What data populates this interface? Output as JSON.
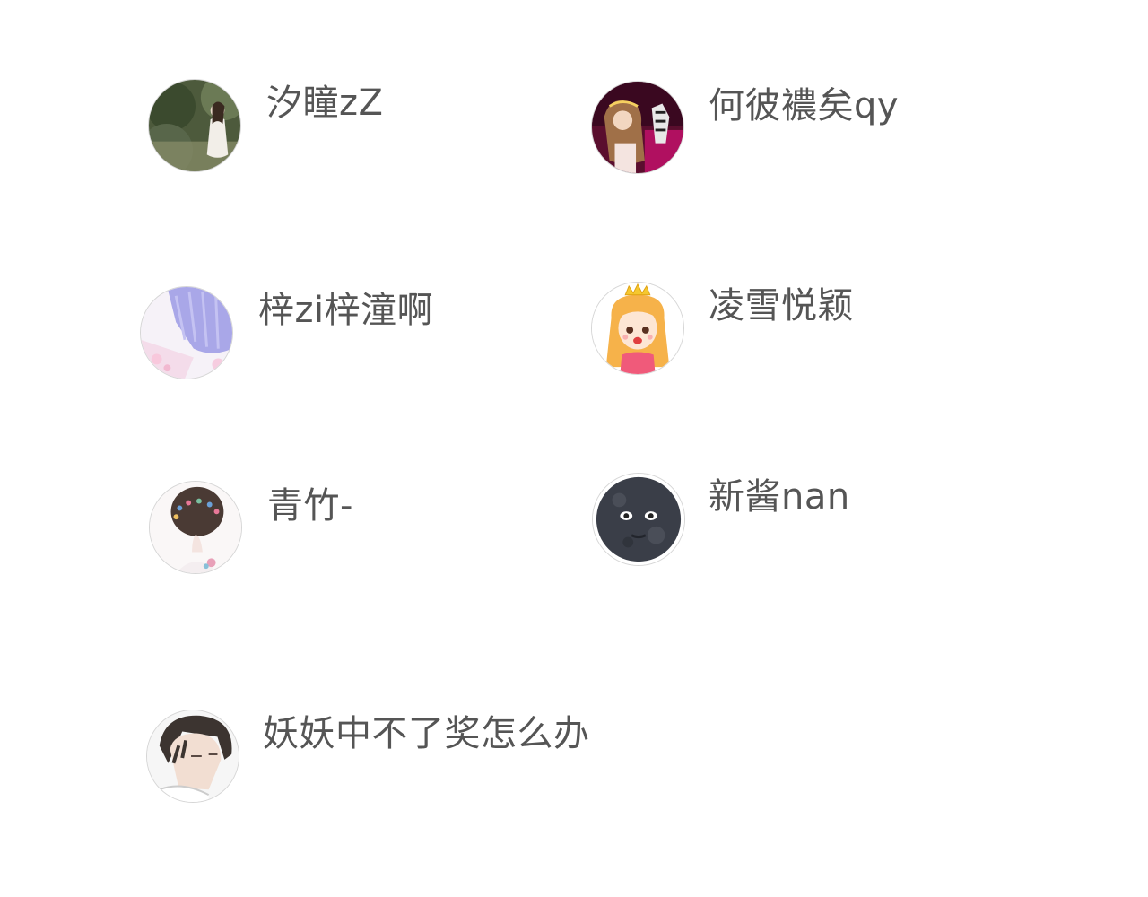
{
  "users": [
    {
      "name": "汐瞳zZ"
    },
    {
      "name": "何彼襛矣qy"
    },
    {
      "name": "梓zi梓潼啊"
    },
    {
      "name": "凌雪悦颖"
    },
    {
      "name": "青竹-"
    },
    {
      "name": "新酱nan"
    },
    {
      "name": "妖妖中不了奖怎么办"
    }
  ]
}
